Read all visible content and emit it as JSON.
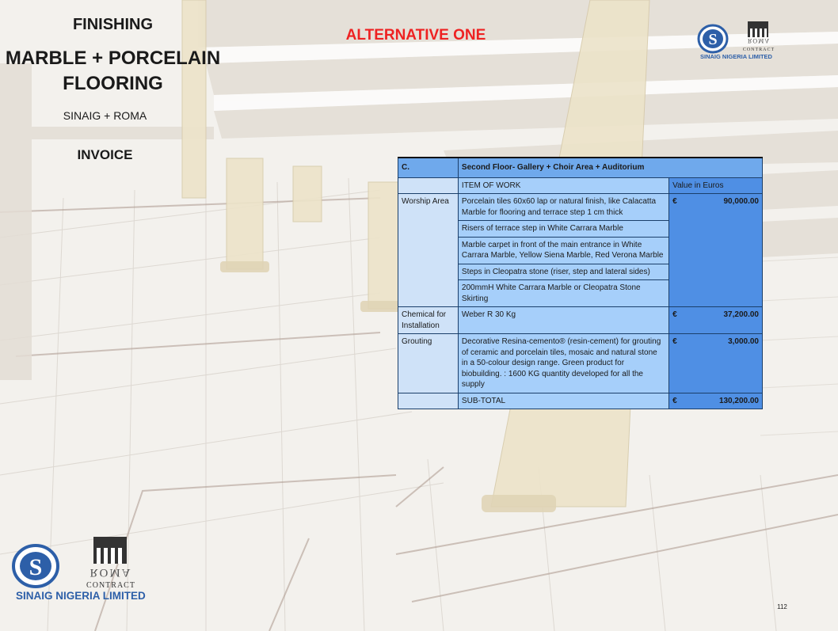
{
  "heading": {
    "section": "FINISHING",
    "title_line1": "MARBLE + PORCELAIN",
    "title_line2": "FLOORING",
    "subtitle": "SINAIG + ROMA",
    "doc_type": "INVOICE",
    "alternative": "ALTERNATIVE ONE"
  },
  "brand": {
    "company": "SINAIG NIGERIA LIMITED",
    "partner_mark": "ROMA",
    "partner_caption": "CONTRACT",
    "accent_red": "#ee2222",
    "company_blue": "#2d5fa8"
  },
  "table": {
    "code": "C.",
    "section_title": "Second Floor-  Gallery + Choir Area + Auditorium",
    "col_item": "ITEM OF WORK",
    "col_value": "Value in Euros",
    "groups": [
      {
        "category": "Worship Area",
        "currency": "€",
        "amount": "90,000.00",
        "items": [
          "Porcelain tiles 60x60 lap or natural finish, like Calacatta Marble for flooring and terrace step 1 cm thick",
          "Risers of terrace step in White Carrara Marble",
          "Marble carpet in front of the main entrance in White Carrara Marble, Yellow Siena Marble, Red Verona Marble",
          "Steps in Cleopatra stone (riser, step and lateral sides)",
          "200mmH  White Carrara Marble or Cleopatra Stone Skirting"
        ]
      },
      {
        "category": "Chemical for Installation",
        "currency": "€",
        "amount": "37,200.00",
        "items": [
          "Weber R 30 Kg"
        ]
      },
      {
        "category": "Grouting",
        "currency": "€",
        "amount": "3,000.00",
        "items": [
          "Decorative Resina-cemento® (resin-cement) for grouting of ceramic and porcelain tiles, mosaic and natural stone in a 50-colour design range. Green product for biobuilding. : 1600 KG quantity developed for all the supply"
        ]
      }
    ],
    "subtotal_label": "SUB-TOTAL",
    "subtotal_currency": "€",
    "subtotal_amount": "130,200.00"
  },
  "page_number": "112"
}
